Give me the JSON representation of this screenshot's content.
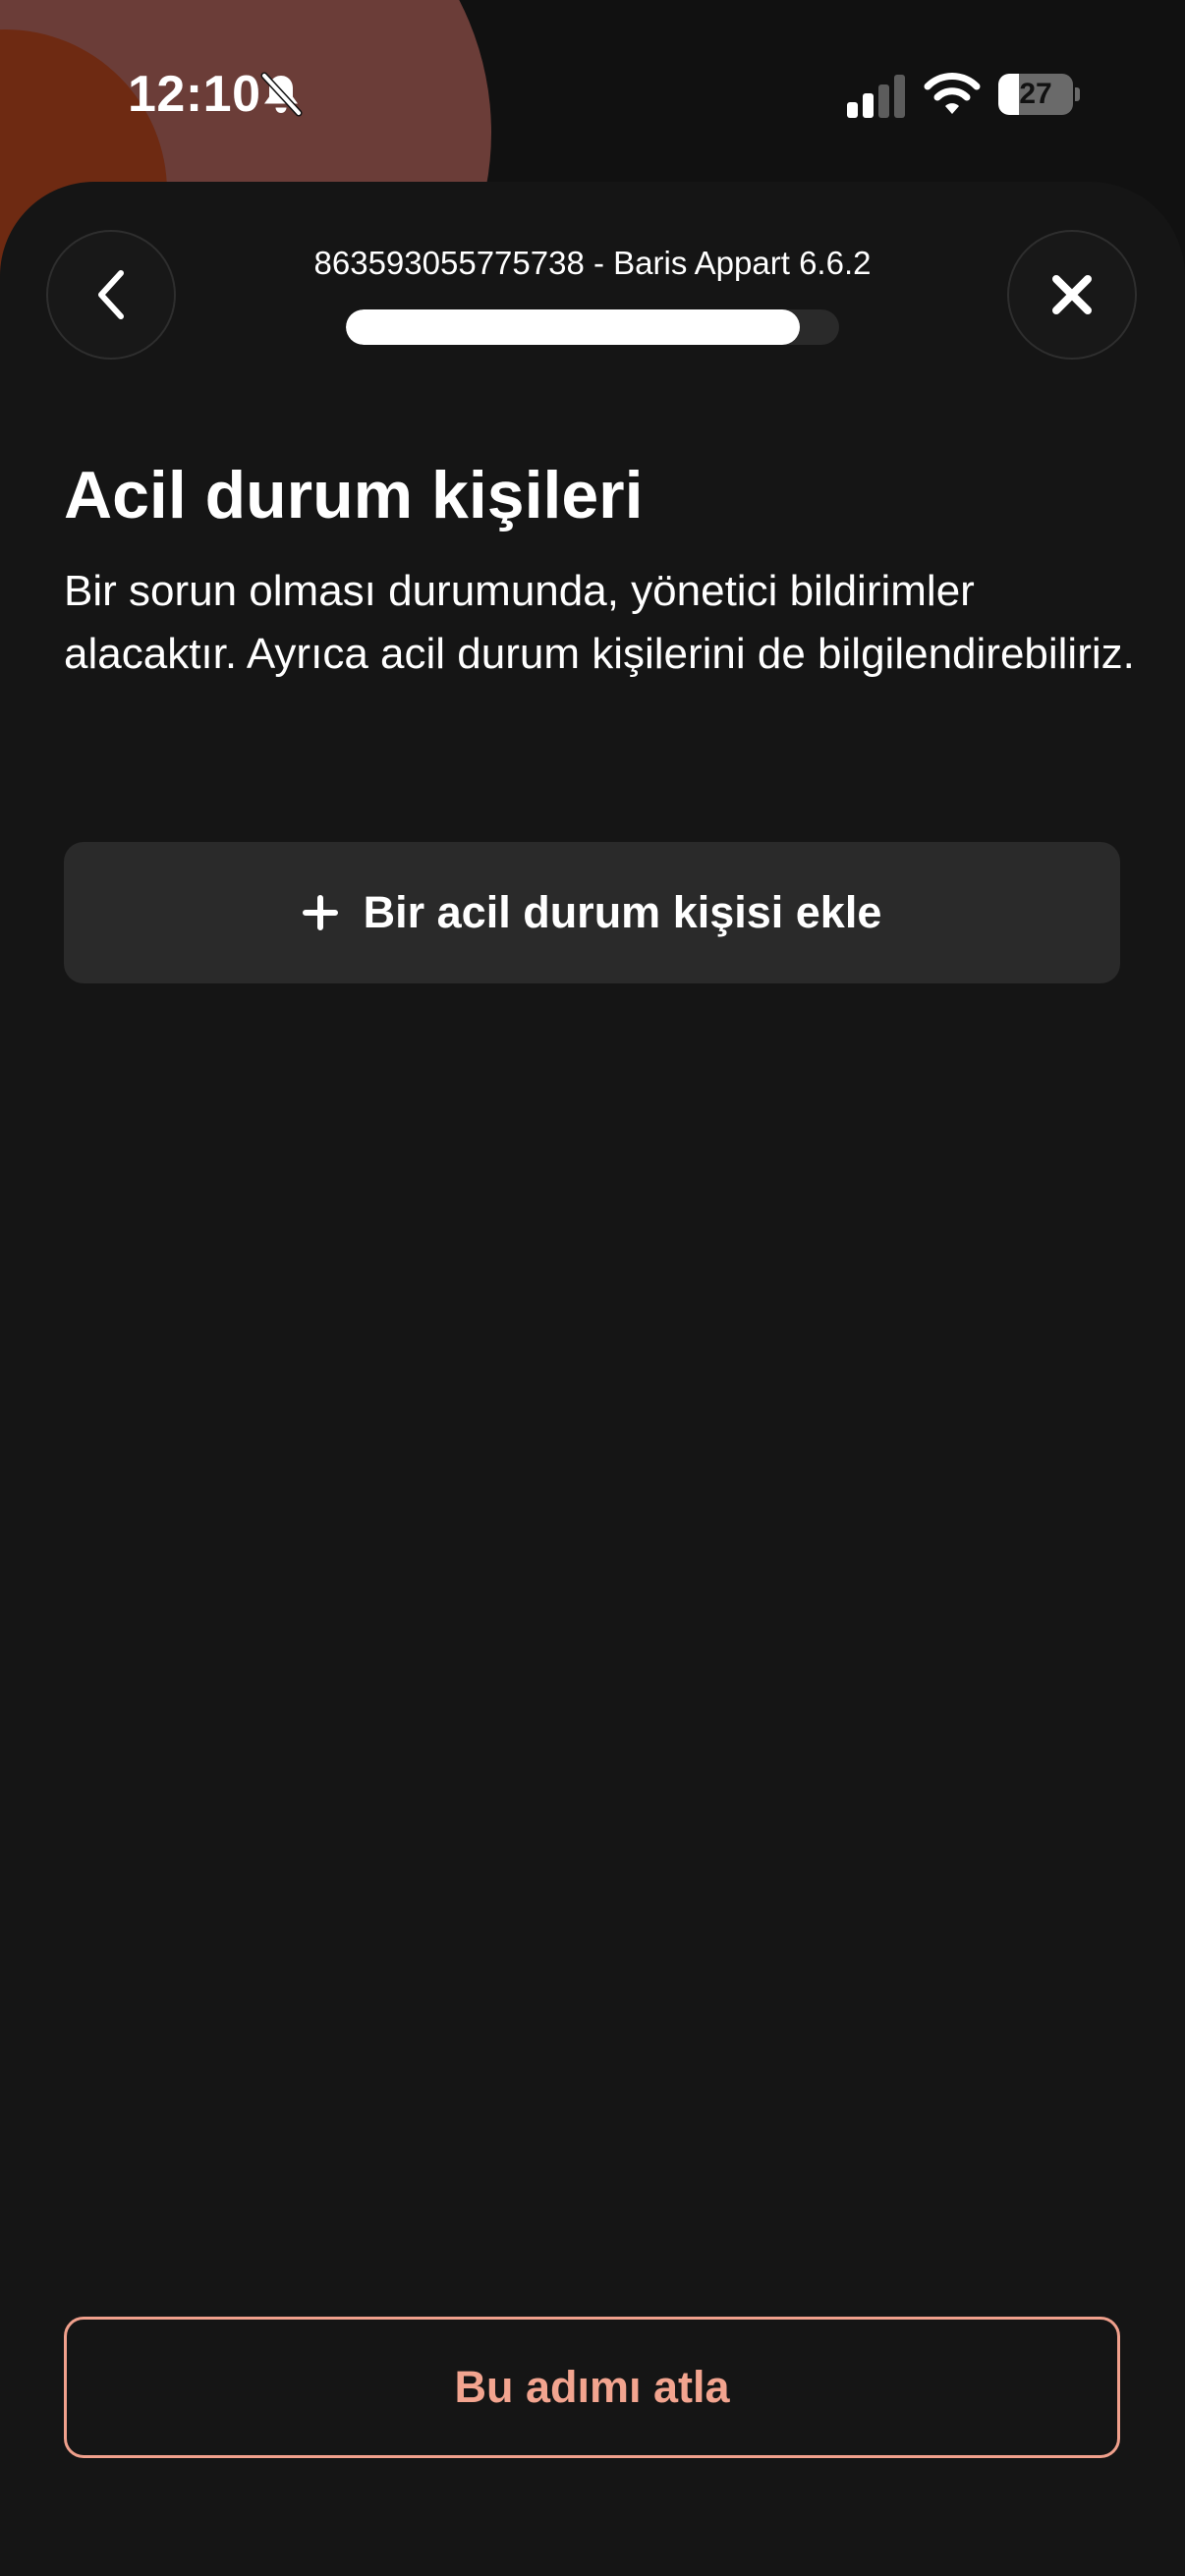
{
  "status_bar": {
    "time": "12:10",
    "battery_level": "27",
    "battery_fraction": 0.27,
    "icons": [
      "bell-slash-icon",
      "cellular-signal-icon",
      "wifi-icon",
      "battery-icon"
    ]
  },
  "header": {
    "title": "863593055775738 - Baris Appart 6.6.2",
    "progress_fraction": 0.92,
    "back_icon": "chevron-left-icon",
    "close_icon": "close-icon"
  },
  "main": {
    "title": "Acil durum kişileri",
    "description": "Bir sorun olması durumunda, yönetici bildirimler alacaktır. Ayrıca acil durum kişilerini de bilgilendirebiliriz.",
    "add_contact": {
      "icon": "plus-icon",
      "label": "Bir acil durum kişisi ekle"
    }
  },
  "footer": {
    "skip_label": "Bu adımı atla"
  },
  "colors": {
    "background": "#151515",
    "button_surface": "#2a2a2a",
    "accent": "#f2a48f",
    "decor_circle_1": "#6b3d38",
    "decor_circle_2": "#6e2a12"
  }
}
